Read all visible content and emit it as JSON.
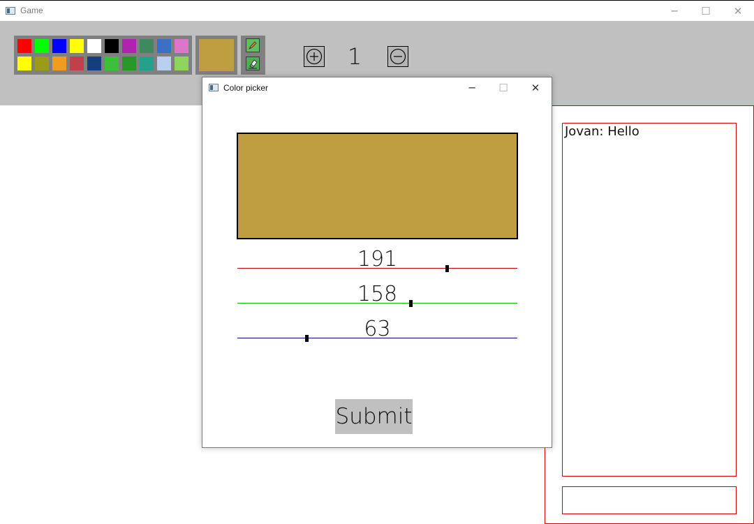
{
  "window": {
    "title": "Game",
    "minimize_glyph": "─",
    "maximize_glyph": "☐",
    "close_glyph": "✕"
  },
  "toolbar": {
    "palette_row1": [
      "#ff0000",
      "#00ff00",
      "#0000ff",
      "#ffff00",
      "#ffffff",
      "#000000",
      "#b022b0",
      "#3e8a5e",
      "#3a6fc4",
      "#dc76c8"
    ],
    "palette_row2": [
      "#ffff00",
      "#9b9b19",
      "#f09c1f",
      "#c0404c",
      "#163e7c",
      "#3cc03c",
      "#2a962a",
      "#25a08a",
      "#b8cff0",
      "#8ed45e"
    ],
    "current_color": "#bf9e3f",
    "tools": [
      "pencil-icon",
      "eraser-icon"
    ],
    "brush_size": "1",
    "zoom_in_icon": "plus-circle-icon",
    "zoom_out_icon": "minus-circle-icon"
  },
  "chat": {
    "messages": [
      "Jovan: Hello"
    ],
    "input_value": "",
    "border_color": "#d60000"
  },
  "dialog": {
    "title": "Color picker",
    "minimize_glyph": "─",
    "maximize_glyph": "☐",
    "close_glyph": "✕",
    "preview_color": "#bf9e3f",
    "sliders": [
      {
        "channel": "red",
        "value": "191",
        "fraction": 0.749,
        "track_color": "#c00000"
      },
      {
        "channel": "green",
        "value": "158",
        "fraction": 0.62,
        "track_color": "#00c000"
      },
      {
        "channel": "blue",
        "value": "63",
        "fraction": 0.247,
        "track_color": "#000080"
      }
    ],
    "submit_label": "Submit"
  }
}
